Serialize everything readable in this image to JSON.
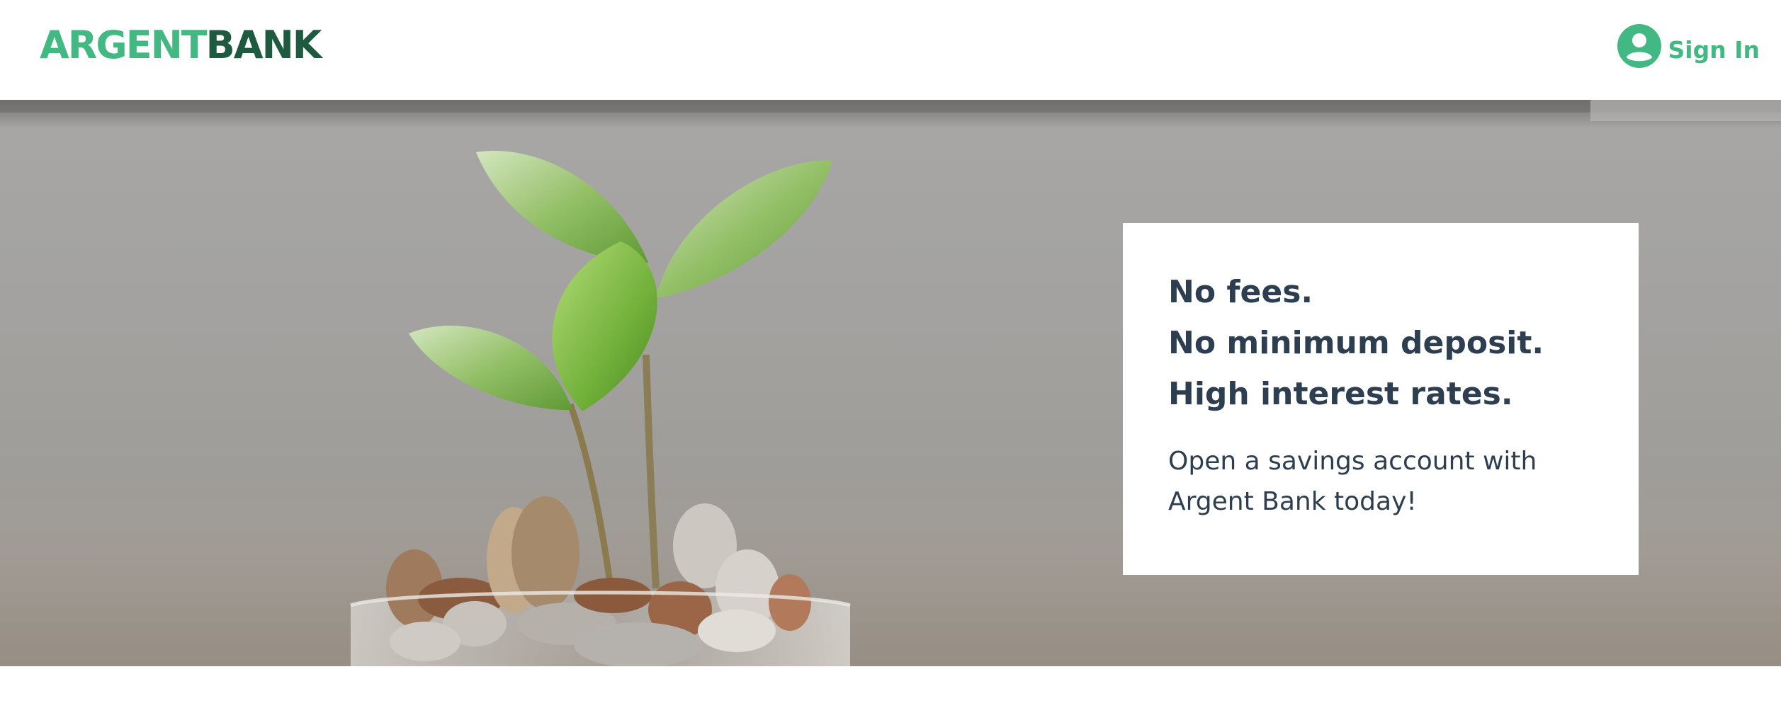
{
  "header": {
    "logo_part1": "ARGENT",
    "logo_part2": "BANK",
    "sign_in_label": "Sign In",
    "sign_in_icon": "user-circle-icon"
  },
  "hero": {
    "image_subject": "plant-sprout-in-coins-jar",
    "subtitles": [
      "No fees.",
      "No minimum deposit.",
      "High interest rates."
    ],
    "text_line1": "Open a savings account with",
    "text_line2": "Argent Bank today!"
  },
  "colors": {
    "brand_green": "#42b983",
    "brand_dark_green": "#1d5a3f",
    "text_dark": "#2c3e50"
  }
}
